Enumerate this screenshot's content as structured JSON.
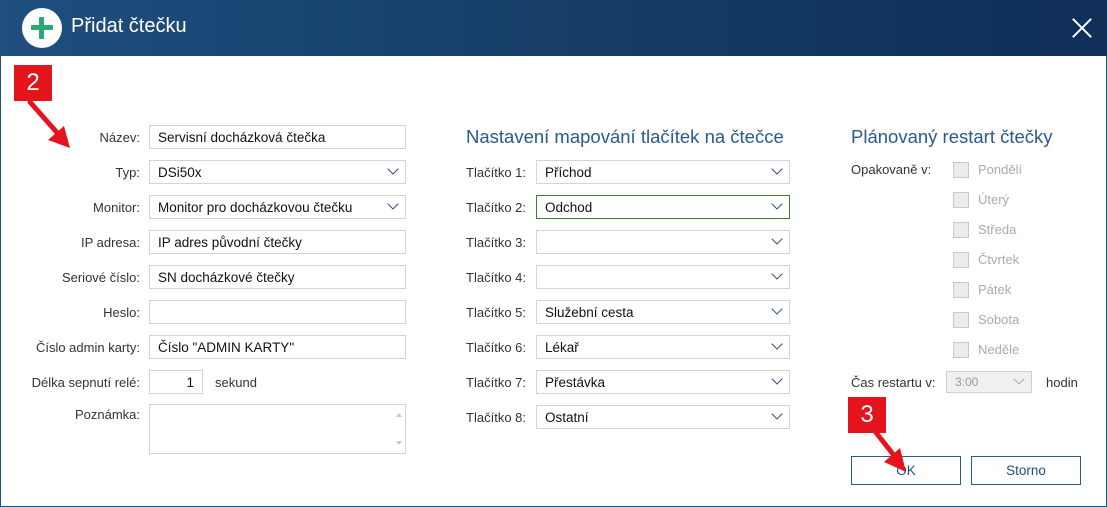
{
  "window": {
    "title": "Přidat čtečku",
    "icon": "plus-circle-icon",
    "close_icon": "close-icon"
  },
  "left": {
    "name_label": "Název:",
    "name_value": "Servisní docházková čtečka",
    "type_label": "Typ:",
    "type_value": "DSi50x",
    "monitor_label": "Monitor:",
    "monitor_value": "Monitor pro docházkovou čtečku",
    "ip_label": "IP adresa:",
    "ip_value": "IP adres původní čtečky",
    "serial_label": "Seriové číslo:",
    "serial_value": "SN docházkové čtečky",
    "password_label": "Heslo:",
    "password_value": "",
    "admin_card_label": "Číslo admin karty:",
    "admin_card_value": "Číslo \"ADMIN KARTY\"",
    "relay_label": "Délka sepnutí relé:",
    "relay_value": "1",
    "relay_unit": "sekund",
    "note_label": "Poznámka:",
    "note_value": ""
  },
  "mapping": {
    "title": "Nastavení mapování tlačítek na čtečce",
    "buttons": [
      {
        "label": "Tlačítko 1:",
        "value": "Příchod"
      },
      {
        "label": "Tlačítko 2:",
        "value": "Odchod"
      },
      {
        "label": "Tlačítko 3:",
        "value": ""
      },
      {
        "label": "Tlačítko 4:",
        "value": ""
      },
      {
        "label": "Tlačítko 5:",
        "value": "Služební cesta"
      },
      {
        "label": "Tlačítko 6:",
        "value": "Lékař"
      },
      {
        "label": "Tlačítko 7:",
        "value": "Přestávka"
      },
      {
        "label": "Tlačítko 8:",
        "value": "Ostatní"
      }
    ]
  },
  "restart": {
    "title": "Plánovaný restart čtečky",
    "repeat_label": "Opakovaně v:",
    "days": [
      "Pondělí",
      "Úterý",
      "Středa",
      "Čtvrtek",
      "Pátek",
      "Sobota",
      "Neděle"
    ],
    "time_label": "Čas restartu v:",
    "time_value": "3:00",
    "time_unit": "hodin"
  },
  "actions": {
    "ok_label": "OK",
    "cancel_label": "Storno"
  },
  "annotations": {
    "badge_2": "2",
    "badge_3": "3"
  },
  "colors": {
    "titlebar": "#1e4f7f",
    "accent": "#2b5a8c",
    "badge": "#e3141b",
    "plus": "#2aa876"
  }
}
